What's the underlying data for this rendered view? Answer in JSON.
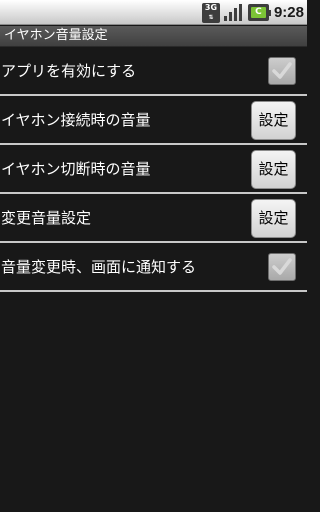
{
  "status_bar": {
    "network": "3G",
    "time": "9:28",
    "icons": [
      "network-3g-icon",
      "signal-icon",
      "battery-icon"
    ]
  },
  "app": {
    "title": "イヤホン音量設定"
  },
  "preferences": [
    {
      "label": "アプリを有効にする",
      "control": "checkbox",
      "checked": true
    },
    {
      "label": "イヤホン接続時の音量",
      "control": "button",
      "button_label": "設定"
    },
    {
      "label": "イヤホン切断時の音量",
      "control": "button",
      "button_label": "設定"
    },
    {
      "label": "変更音量設定",
      "control": "button",
      "button_label": "設定"
    },
    {
      "label": "音量変更時、画面に通知する",
      "control": "checkbox",
      "checked": true
    }
  ],
  "colors": {
    "background": "#181818",
    "title_bar": "#4a4a4a",
    "divider": "#c8c8c8",
    "battery_fill": "#7cc436"
  }
}
